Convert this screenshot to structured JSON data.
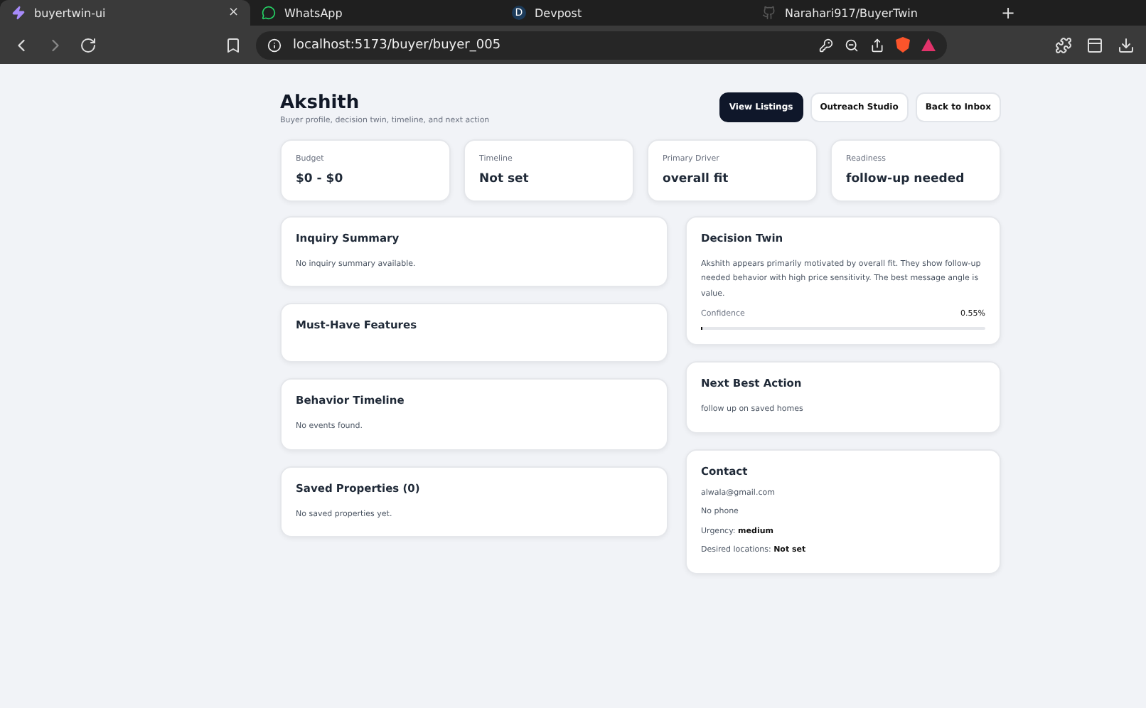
{
  "browser": {
    "tabs": [
      {
        "title": "buyertwin-ui",
        "selected": true,
        "kind": "bolt",
        "close": "×"
      },
      {
        "title": "WhatsApp",
        "selected": false,
        "kind": "whatsapp"
      },
      {
        "title": "Devpost",
        "selected": false,
        "kind": "letter",
        "letter": "D"
      },
      {
        "title": "Narahari917/BuyerTwin",
        "selected": false,
        "kind": "github"
      }
    ],
    "new_tab": "+",
    "address": "localhost:5173/buyer/buyer_005"
  },
  "header": {
    "title": "Akshith",
    "subtitle": "Buyer profile, decision twin, timeline, and next action",
    "buttons": [
      {
        "label": "View Listings",
        "primary": true
      },
      {
        "label": "Outreach Studio",
        "primary": false
      },
      {
        "label": "Back to Inbox",
        "primary": false
      }
    ]
  },
  "stats": [
    {
      "label": "Budget",
      "value": "$0 - $0"
    },
    {
      "label": "Timeline",
      "value": "Not set"
    },
    {
      "label": "Primary Driver",
      "value": "overall fit"
    },
    {
      "label": "Readiness",
      "value": "follow-up needed"
    }
  ],
  "left_cards": [
    {
      "title": "Inquiry Summary",
      "text": "No inquiry summary available."
    },
    {
      "title": "Must-Have Features"
    },
    {
      "title": "Behavior Timeline",
      "text": "No events found."
    },
    {
      "title": "Saved Properties (0)",
      "text": "No saved properties yet."
    }
  ],
  "decision_twin": {
    "title": "Decision Twin",
    "text": "Akshith appears primarily motivated by overall fit. They show follow-up needed behavior with high price sensitivity. The best message angle is value.",
    "confidence_label": "Confidence",
    "confidence_reading": "0.55%",
    "level": 0.0055
  },
  "next_best_action": {
    "title": "Next Best Action",
    "text": "follow up on saved homes"
  },
  "contact": {
    "title": "Contact",
    "email": "alwala@gmail.com",
    "phone": "No phone",
    "details": [
      {
        "label": "Urgency:",
        "value": "medium"
      },
      {
        "label": "Desired locations:",
        "value": "Not set"
      }
    ]
  }
}
